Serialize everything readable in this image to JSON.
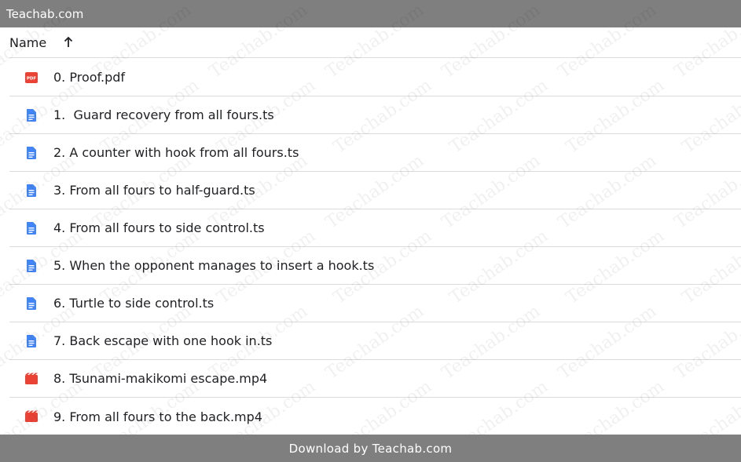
{
  "topbar": {
    "site": "Teachab.com"
  },
  "header": {
    "name_label": "Name",
    "sort_icon": "arrow-up-icon"
  },
  "files": [
    {
      "name": "0. Proof.pdf",
      "type": "pdf"
    },
    {
      "name": "1.  Guard recovery from all fours.ts",
      "type": "doc"
    },
    {
      "name": "2. A counter with hook from all fours.ts",
      "type": "doc"
    },
    {
      "name": "3. From all fours to half-guard.ts",
      "type": "doc"
    },
    {
      "name": "4. From all fours to side control.ts",
      "type": "doc"
    },
    {
      "name": "5. When the opponent manages to insert a hook.ts",
      "type": "doc"
    },
    {
      "name": "6. Turtle to side control.ts",
      "type": "doc"
    },
    {
      "name": "7. Back escape with one hook in.ts",
      "type": "doc"
    },
    {
      "name": "8. Tsunami-makikomi escape.mp4",
      "type": "video"
    },
    {
      "name": "9. From all fours to the back.mp4",
      "type": "video"
    }
  ],
  "footer": {
    "text": "Download by Teachab.com"
  },
  "watermark": {
    "text": "Teachab.com"
  },
  "colors": {
    "bar": "#7f7f7f",
    "pdf": "#ea4335",
    "doc": "#4285f4",
    "video": "#ea4335",
    "divider": "#dadce0"
  }
}
